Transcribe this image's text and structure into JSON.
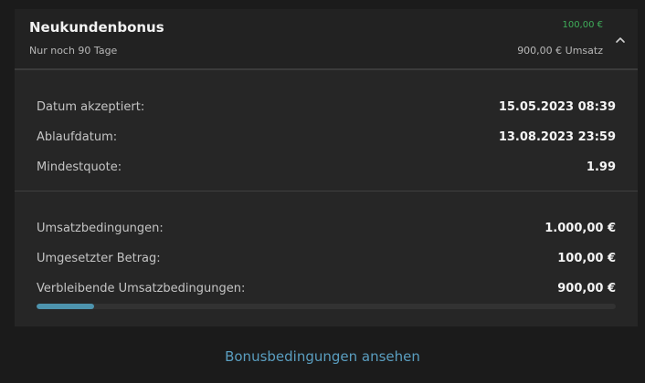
{
  "bonus": {
    "title": "Neukundenbonus",
    "subtitle": "Nur noch 90 Tage",
    "amount": "100,00 €",
    "turnover": "900,00 € Umsatz",
    "colors": {
      "amount": "#3fae5a",
      "progress": "#4d93ad"
    }
  },
  "details": {
    "accepted_label": "Datum akzeptiert:",
    "accepted_value": "15.05.2023 08:39",
    "expiry_label": "Ablaufdatum:",
    "expiry_value": "13.08.2023 23:59",
    "min_odds_label": "Mindestquote:",
    "min_odds_value": "1.99"
  },
  "wagering": {
    "requirement_label": "Umsatzbedingungen:",
    "requirement_value": "1.000,00 €",
    "wagered_label": "Umgesetzter Betrag:",
    "wagered_value": "100,00 €",
    "remaining_label": "Verbleibende Umsatzbedingungen:",
    "remaining_value": "900,00 €",
    "progress_fraction": 0.1
  },
  "footer": {
    "terms_link": "Bonusbedingungen ansehen"
  },
  "icons": {
    "toggle": "chevron-up-icon"
  }
}
